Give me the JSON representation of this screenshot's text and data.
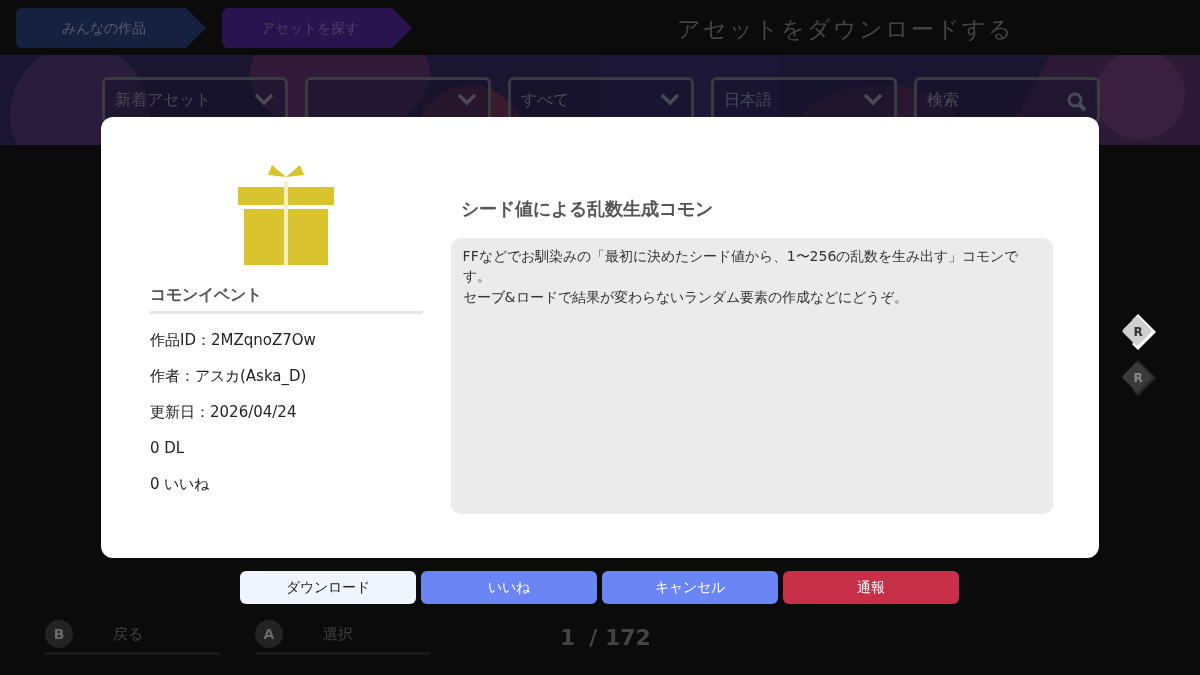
{
  "tabs": [
    {
      "label": "みんなの作品",
      "selected": false
    },
    {
      "label": "アセットを探す",
      "selected": true
    }
  ],
  "page_title": "アセットをダウンロードする",
  "filters": [
    {
      "kind": "dropdown",
      "value": "新着アセット"
    },
    {
      "kind": "dropdown"
    },
    {
      "kind": "dropdown",
      "value": "すべて"
    },
    {
      "kind": "dropdown",
      "value": "日本語"
    },
    {
      "kind": "search",
      "placeholder": "検索"
    }
  ],
  "dialog": {
    "category": "コモンイベント",
    "details": [
      "作品ID：2MZqnoZ7Ow",
      "作者：アスカ(Aska_D)",
      "更新日：2026/04/24",
      "0 DL",
      "0 いいね"
    ],
    "title": "シード値による乱数生成コモン",
    "description": [
      "FFなどでお馴染みの「最初に決めたシード値から、1〜256の乱数を生み出す」コモンです。",
      "セーブ&ロードで結果が変わらないランダム要素の作成などにどうぞ。"
    ]
  },
  "dialog_buttons": [
    {
      "label": "ダウンロード",
      "kind": "light"
    },
    {
      "label": "いいね",
      "kind": "primary"
    },
    {
      "label": "キャンセル",
      "kind": "primary"
    },
    {
      "label": "通報",
      "kind": "danger"
    }
  ],
  "page_switch": [
    {
      "label": "R",
      "disabled": false
    },
    {
      "label": "R",
      "disabled": true
    }
  ],
  "footer": [
    {
      "key": "B",
      "label": "戻る"
    },
    {
      "key": "A",
      "label": "選択"
    }
  ],
  "pager": {
    "current": "1",
    "total": "/ 172"
  }
}
